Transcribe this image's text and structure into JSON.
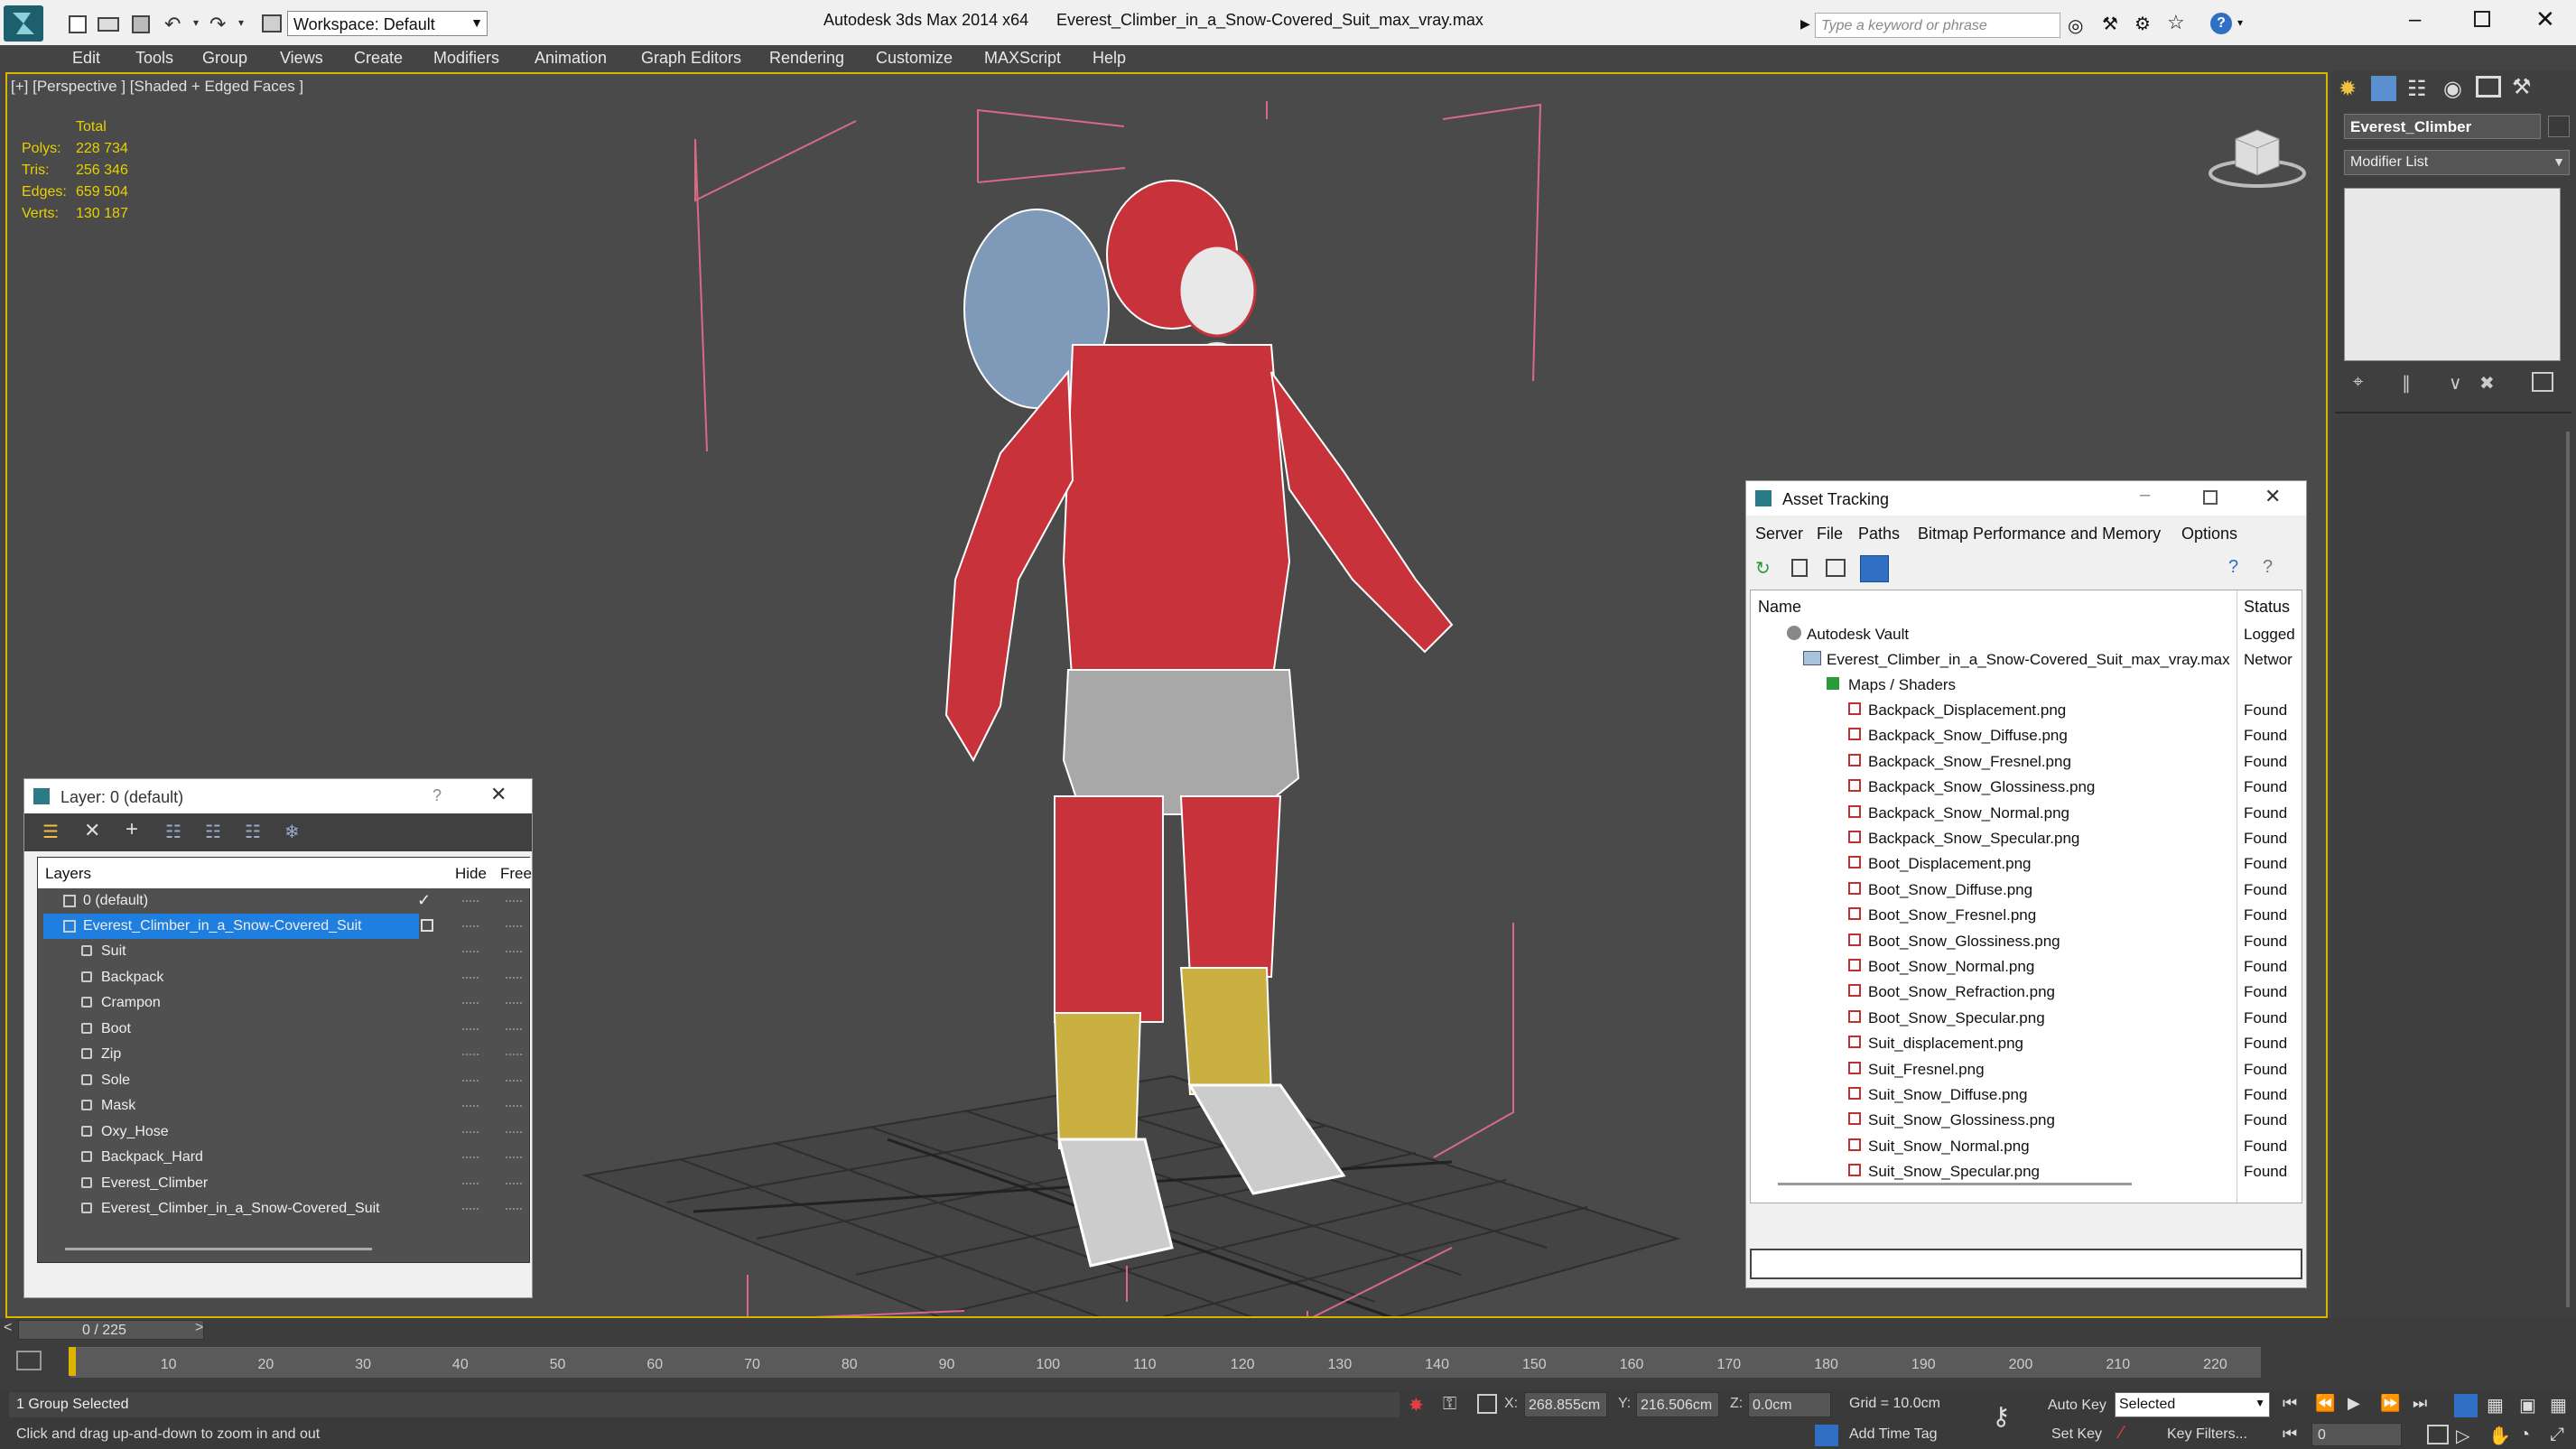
{
  "titlebar": {
    "workspace_label": "Workspace: Default",
    "app_title": "Autodesk 3ds Max  2014 x64",
    "file_title": "Everest_Climber_in_a_Snow-Covered_Suit_max_vray.max",
    "search_placeholder": "Type a keyword or phrase"
  },
  "menu": [
    "Edit",
    "Tools",
    "Group",
    "Views",
    "Create",
    "Modifiers",
    "Animation",
    "Graph Editors",
    "Rendering",
    "Customize",
    "MAXScript",
    "Help"
  ],
  "viewport": {
    "label": "[+] [Perspective ] [Shaded + Edged Faces ]",
    "stats": {
      "total_label": "Total",
      "polys_label": "Polys:",
      "polys": "228 734",
      "tris_label": "Tris:",
      "tris": "256 346",
      "edges_label": "Edges:",
      "edges": "659 504",
      "verts_label": "Verts:",
      "verts": "130 187"
    }
  },
  "command_panel": {
    "object_name": "Everest_Climber",
    "modifier_list": "Modifier List"
  },
  "asset_tracking": {
    "title": "Asset Tracking",
    "menu": [
      "Server",
      "File",
      "Paths",
      "Bitmap Performance and Memory",
      "Options"
    ],
    "col_name": "Name",
    "col_status": "Status",
    "vault": {
      "name": "Autodesk Vault",
      "status": "Logged"
    },
    "maxfile": {
      "name": "Everest_Climber_in_a_Snow-Covered_Suit_max_vray.max",
      "status": "Networ"
    },
    "group": "Maps / Shaders",
    "files": [
      {
        "name": "Backpack_Displacement.png",
        "status": "Found"
      },
      {
        "name": "Backpack_Snow_Diffuse.png",
        "status": "Found"
      },
      {
        "name": "Backpack_Snow_Fresnel.png",
        "status": "Found"
      },
      {
        "name": "Backpack_Snow_Glossiness.png",
        "status": "Found"
      },
      {
        "name": "Backpack_Snow_Normal.png",
        "status": "Found"
      },
      {
        "name": "Backpack_Snow_Specular.png",
        "status": "Found"
      },
      {
        "name": "Boot_Displacement.png",
        "status": "Found"
      },
      {
        "name": "Boot_Snow_Diffuse.png",
        "status": "Found"
      },
      {
        "name": "Boot_Snow_Fresnel.png",
        "status": "Found"
      },
      {
        "name": "Boot_Snow_Glossiness.png",
        "status": "Found"
      },
      {
        "name": "Boot_Snow_Normal.png",
        "status": "Found"
      },
      {
        "name": "Boot_Snow_Refraction.png",
        "status": "Found"
      },
      {
        "name": "Boot_Snow_Specular.png",
        "status": "Found"
      },
      {
        "name": "Suit_displacement.png",
        "status": "Found"
      },
      {
        "name": "Suit_Fresnel.png",
        "status": "Found"
      },
      {
        "name": "Suit_Snow_Diffuse.png",
        "status": "Found"
      },
      {
        "name": "Suit_Snow_Glossiness.png",
        "status": "Found"
      },
      {
        "name": "Suit_Snow_Normal.png",
        "status": "Found"
      },
      {
        "name": "Suit_Snow_Specular.png",
        "status": "Found"
      }
    ]
  },
  "layer_window": {
    "title": "Layer: 0 (default)",
    "help": "?",
    "col_layers": "Layers",
    "col_hide": "Hide",
    "col_freeze": "Free",
    "default_layer": "0 (default)",
    "main_layer": "Everest_Climber_in_a_Snow-Covered_Suit",
    "objects": [
      "Suit",
      "Backpack",
      "Crampon",
      "Boot",
      "Zip",
      "Sole",
      "Mask",
      "Oxy_Hose",
      "Backpack_Hard",
      "Everest_Climber",
      "Everest_Climber_in_a_Snow-Covered_Suit"
    ]
  },
  "timeline": {
    "frame": "0 / 225",
    "ticks": [
      "10",
      "20",
      "30",
      "40",
      "50",
      "60",
      "70",
      "80",
      "90",
      "100",
      "110",
      "120",
      "130",
      "140",
      "150",
      "160",
      "170",
      "180",
      "190",
      "200",
      "210",
      "220"
    ]
  },
  "status": {
    "selection": "1 Group Selected",
    "prompt": "Click and drag up-and-down to zoom in and out",
    "x_label": "X:",
    "x": "268.855cm",
    "y_label": "Y:",
    "y": "216.506cm",
    "z_label": "Z:",
    "z": "0.0cm",
    "grid": "Grid = 10.0cm",
    "auto_key": "Auto Key",
    "selected": "Selected",
    "set_key": "Set Key",
    "key_filters": "Key Filters...",
    "add_time_tag": "Add Time Tag",
    "frame_value": "0"
  },
  "colors": {
    "accent": "#d9b400",
    "selection": "#1e7fe0",
    "wire_red": "#c8323a"
  }
}
